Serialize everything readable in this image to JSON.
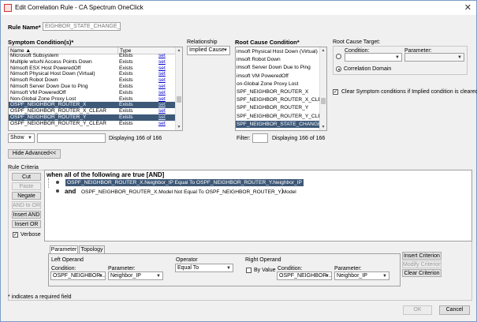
{
  "window": {
    "title": "Edit Correlation Rule - CA Spectrum OneClick",
    "close": "✕"
  },
  "rule_name": {
    "label": "Rule Name*",
    "value": "EIGHBOR_STATE_CHANGE_RULE"
  },
  "symptom": {
    "title": "Symptom Condition(s)*",
    "columns": [
      "Name",
      "Type"
    ],
    "sort_indicator": "▲",
    "rows": [
      {
        "name": "Microsoft Subsystem",
        "type": "Exists",
        "link": "set",
        "selected": false
      },
      {
        "name": "Multiple wlsxN Access Points Down",
        "type": "Exists",
        "link": "set",
        "selected": false
      },
      {
        "name": "Nimsoft ESX Host PoweredOff",
        "type": "Exists",
        "link": "set",
        "selected": false
      },
      {
        "name": "Nimsoft Physical Host Down (Virtual)",
        "type": "Exists",
        "link": "set",
        "selected": false
      },
      {
        "name": "Nimsoft Robot Down",
        "type": "Exists",
        "link": "set",
        "selected": false
      },
      {
        "name": "Nimsoft Server Down Due to Ping",
        "type": "Exists",
        "link": "set",
        "selected": false
      },
      {
        "name": "Nimsoft VM PoweredOff",
        "type": "Exists",
        "link": "set",
        "selected": false
      },
      {
        "name": "Non-Global Zone Proxy Lost",
        "type": "Exists",
        "link": "set",
        "selected": false
      },
      {
        "name": "OSPF_NEIGHBOR_ROUTER_X",
        "type": "Exists",
        "link": "set",
        "selected": true
      },
      {
        "name": "OSPF_NEIGHBOR_ROUTER_X_CLEAR",
        "type": "Exists",
        "link": "set",
        "selected": false
      },
      {
        "name": "OSPF_NEIGHBOR_ROUTER_Y",
        "type": "Exists",
        "link": "set",
        "selected": true
      },
      {
        "name": "OSPF_NEIGHBOR_ROUTER_Y_CLEAR",
        "type": "Exists",
        "link": "set",
        "selected": false
      }
    ],
    "show_label": "Show",
    "displaying": "Displaying 166 of 166"
  },
  "relationship": {
    "label": "Relationship",
    "value": "Implied Cause"
  },
  "root_cause": {
    "title": "Root Cause Condition*",
    "items": [
      {
        "text": "imsoft Physical Host Down (Virtual)",
        "selected": false
      },
      {
        "text": "imsoft Robot Down",
        "selected": false
      },
      {
        "text": "imsoft Server Down Due to Ping",
        "selected": false
      },
      {
        "text": "imsoft VM PoweredOff",
        "selected": false
      },
      {
        "text": "on-Global Zone Proxy Lost",
        "selected": false
      },
      {
        "text": "SPF_NEIGHBOR_ROUTER_X",
        "selected": false
      },
      {
        "text": "SPF_NEIGHBOR_ROUTER_X_CLEAR",
        "selected": false
      },
      {
        "text": "SPF_NEIGHBOR_ROUTER_Y",
        "selected": false
      },
      {
        "text": "SPF_NEIGHBOR_ROUTER_Y_CLEAR",
        "selected": false
      },
      {
        "text": "SPF_NEIGHBOR_STATE_CHANGE",
        "selected": true
      }
    ],
    "filter_label": "Filter:",
    "displaying": "Displaying 166 of 166"
  },
  "target": {
    "title": "Root Cause Target:",
    "condition_label": "Condition:",
    "parameter_label": "Parameter:",
    "domain_label": "Correlation Domain"
  },
  "clear_symptom": {
    "label": "Clear Symptom conditions if Implied condition is cleared",
    "checked": true
  },
  "hide_advanced": "Hide Advanced<<",
  "criteria": {
    "title": "Rule Criteria",
    "buttons": {
      "cut": "Cut",
      "paste": "Paste",
      "negate": "Negate",
      "and_to_or": "AND to OR",
      "insert_and": "Insert AND",
      "insert_or": "Insert OR"
    },
    "verbose": "Verbose",
    "header": "when all of the following are true [AND]",
    "line1": "OSPF_NEIGHBOR_ROUTER_X.Neighbor_IP  Equal To  OSPF_NEIGHBOR_ROUTER_Y.Neighbor_IP",
    "line1_suffix": ",",
    "and_word": "and",
    "line2": "OSPF_NEIGHBOR_ROUTER_X.Model  Not Equal To  OSPF_NEIGHBOR_ROUTER_Y.Model",
    "line2_suffix": ")"
  },
  "tabs": {
    "parameter": "Parameter",
    "topology": "Topology"
  },
  "left_operand": {
    "title": "Left Operand",
    "condition_label": "Condition:",
    "condition": "OSPF_NEIGHBOR...",
    "parameter_label": "Parameter:",
    "parameter": "Neighbor_IP"
  },
  "operator": {
    "title": "Operator",
    "value": "Equal To"
  },
  "right_operand": {
    "title": "Right Operand",
    "by_value": "By Value",
    "condition_label": "Condition:",
    "condition": "OSPF_NEIGHBOR...",
    "parameter_label": "Parameter:",
    "parameter": "Neighbor_IP"
  },
  "criterion_buttons": {
    "insert": "Insert Criterion",
    "modify": "Modify Criterion",
    "clear": "Clear Criterion"
  },
  "footnote": "* indicates a required field",
  "footer": {
    "ok": "OK",
    "cancel": "Cancel"
  }
}
